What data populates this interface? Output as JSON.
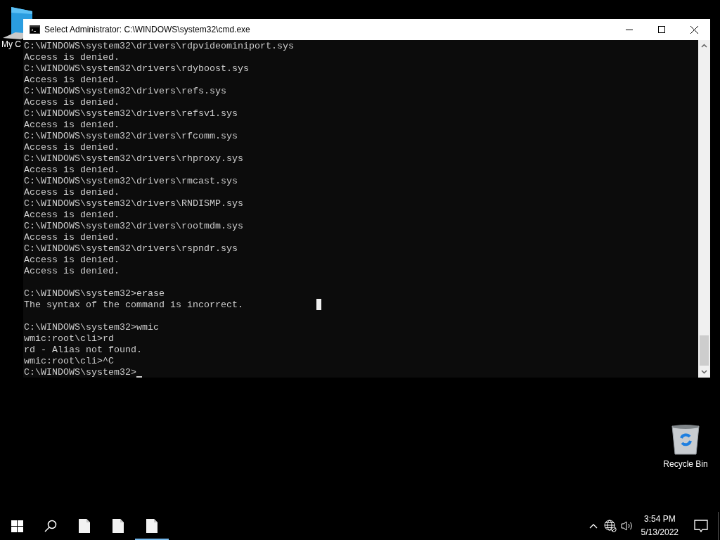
{
  "desktop_icons": [
    {
      "kind": "computer",
      "label": "My C"
    },
    {
      "kind": "recycle-bin",
      "label": "Recycle Bin"
    }
  ],
  "window": {
    "title": "Select Administrator: C:\\WINDOWS\\system32\\cmd.exe",
    "console_blocks": [
      [
        "C:\\WINDOWS\\system32\\drivers\\rdpvideominiport.sys",
        "Access is denied.",
        "C:\\WINDOWS\\system32\\drivers\\rdyboost.sys",
        "Access is denied.",
        "C:\\WINDOWS\\system32\\drivers\\refs.sys",
        "Access is denied.",
        "C:\\WINDOWS\\system32\\drivers\\refsv1.sys",
        "Access is denied.",
        "C:\\WINDOWS\\system32\\drivers\\rfcomm.sys",
        "Access is denied.",
        "C:\\WINDOWS\\system32\\drivers\\rhproxy.sys",
        "Access is denied.",
        "C:\\WINDOWS\\system32\\drivers\\rmcast.sys",
        "Access is denied.",
        "C:\\WINDOWS\\system32\\drivers\\RNDISMP.sys",
        "Access is denied.",
        "C:\\WINDOWS\\system32\\drivers\\rootmdm.sys",
        "Access is denied.",
        "C:\\WINDOWS\\system32\\drivers\\rspndr.sys",
        "Access is denied.",
        "Access is denied."
      ],
      [
        "C:\\WINDOWS\\system32>erase",
        "The syntax of the command is incorrect."
      ],
      [
        "C:\\WINDOWS\\system32>wmic",
        "wmic:root\\cli>rd",
        "rd - Alias not found.",
        "wmic:root\\cli>^C",
        "C:\\WINDOWS\\system32>"
      ]
    ]
  },
  "taskbar": {
    "apps": [
      {
        "selected": false
      },
      {
        "selected": false
      },
      {
        "selected": true
      }
    ],
    "time": "3:54 PM",
    "date": "5/13/2022"
  }
}
